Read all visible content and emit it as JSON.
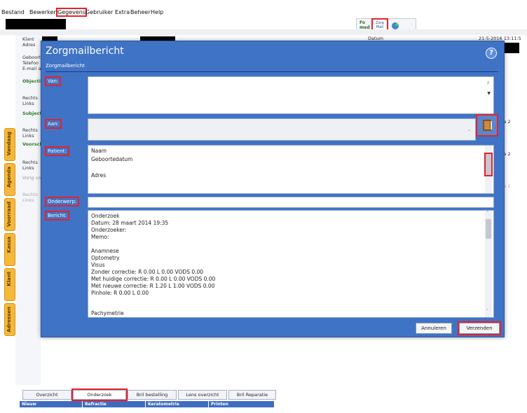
{
  "menu": {
    "items": [
      "Bestand",
      "Bewerken",
      "Gegevens",
      "Gebruiker",
      "Extra",
      "Beheer",
      "Help"
    ]
  },
  "toolbar": {
    "tab1": "Fo med",
    "tab2": "Zorg Mail",
    "datum_label": "Datum",
    "timestamp": "21-5-2016 13:11:5"
  },
  "sidebar": {
    "tabs": [
      "Vandaag",
      "Agenda",
      "Voorraad",
      "Kassa",
      "Klant",
      "Adressen"
    ]
  },
  "background": {
    "klant": "Klant",
    "adres": "Adres",
    "geboorte": "Geboort",
    "telefoon": "Telefoo",
    "email": "E-mail a",
    "objectief": "Objectie",
    "rechts1": "Rechts",
    "links1": "Links",
    "subjectief": "Subjecti",
    "rechts2": "Rechts",
    "links2": "Links",
    "voorschrift": "Voorsch",
    "rechts3": "Rechts",
    "links3": "Links",
    "vorig": "Vorig vo",
    "rechts4": "Rechts",
    "links4": "Links",
    "right1": "ma 2",
    "right2": "ma 2",
    "right3": "ma 2",
    "right_b": "B"
  },
  "dialog": {
    "title": "Zorgmailbericht",
    "subtitle": "Zorgmailbericht",
    "van_label": "Van:",
    "aan_label": "Aan:",
    "patient_label": "Patient:",
    "onderwerp_label": "Onderwerp:",
    "bericht_label": "Bericht:",
    "van_value": "",
    "aan_value": "",
    "onderwerp_value": "",
    "patient_lines": [
      "Naam",
      "Geboortedatum",
      "",
      "Adres"
    ],
    "bericht_lines": [
      "Onderzoek",
      "Datum: 28 maart 2014 19:35",
      "Onderzoeker:",
      "Memo:",
      "",
      "Anamnese",
      "Optometry",
      "Visus",
      "Zonder correctie: R 0.00 L 0.00 VODS 0.00",
      "Met huidige correctie: R 0.00 L 0.00 VODS 0.00",
      "Met nieuwe correctie: R 1.20 L 1.00 VODS 0.00",
      "Pinhole: R 0.00 L 0.00",
      "",
      "Pachymetrie"
    ],
    "cancel_label": "Annuleren",
    "send_label": "Verzenden"
  },
  "bottom_tabs": [
    "Overzicht",
    "Onderzoek",
    "Bril bestelling",
    "Lens overzicht",
    "Bril Reparatie"
  ],
  "bottom_headers": [
    "Nieuw",
    "Refractie",
    "Keratometrie",
    "Printen"
  ],
  "colors": {
    "dialog_blue": "#3f73c6",
    "highlight_red": "#e3222c",
    "sidebar_orange": "#f6b83a"
  }
}
